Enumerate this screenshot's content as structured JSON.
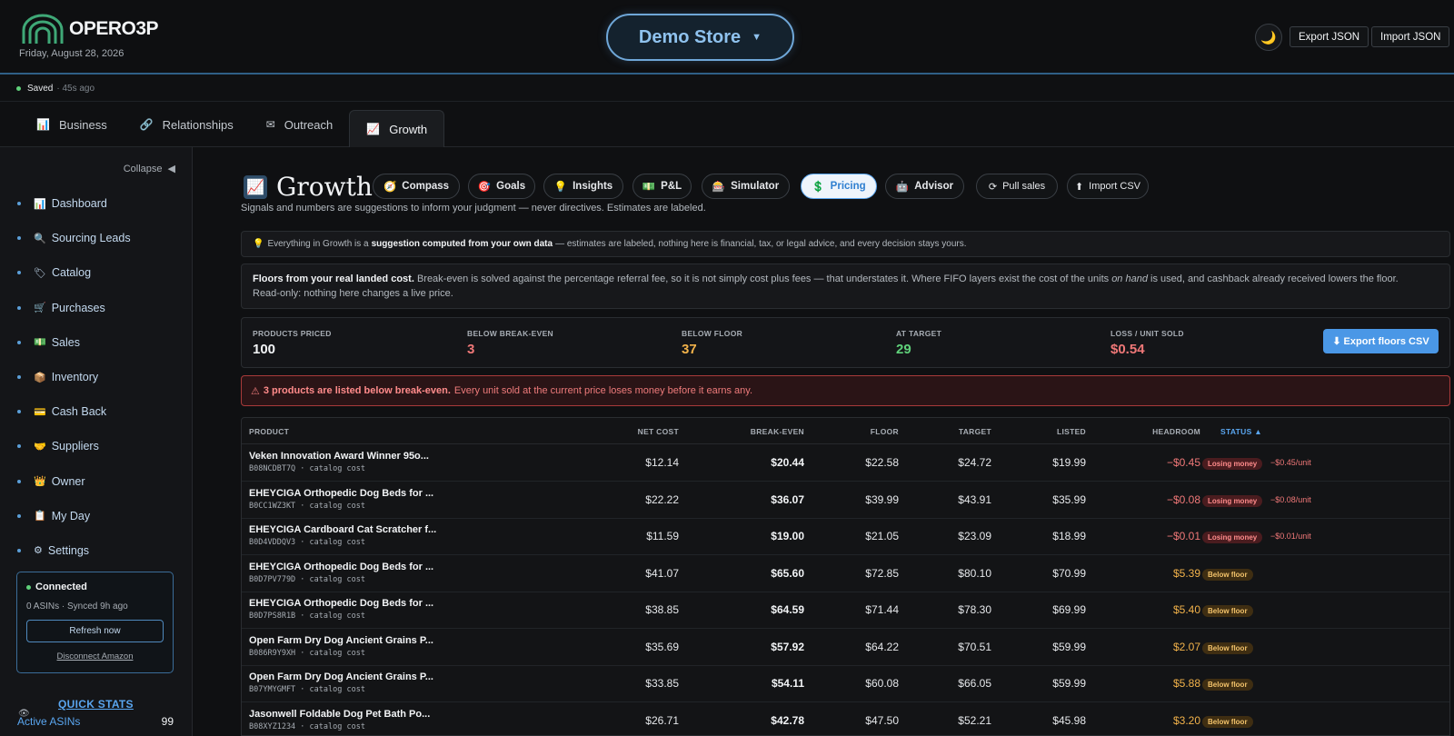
{
  "header": {
    "brand": "OPERO3P",
    "date": "Friday, August 28, 2026",
    "store": "Demo Store",
    "export_json": "Export JSON",
    "import_json": "Import JSON"
  },
  "status": {
    "saved": "Saved",
    "ago": "· 45s ago"
  },
  "tabs": [
    {
      "icon": "📊",
      "label": "Business"
    },
    {
      "icon": "🔗",
      "label": "Relationships"
    },
    {
      "icon": "✉",
      "label": "Outreach"
    },
    {
      "icon": "📈",
      "label": "Growth"
    }
  ],
  "sidebar": {
    "collapse": "Collapse",
    "items": [
      {
        "icon": "📊",
        "label": "Dashboard"
      },
      {
        "icon": "🔍",
        "label": "Sourcing Leads"
      },
      {
        "icon": "🏷",
        "label": "Catalog"
      },
      {
        "icon": "🛒",
        "label": "Purchases"
      },
      {
        "icon": "💵",
        "label": "Sales"
      },
      {
        "icon": "📦",
        "label": "Inventory"
      },
      {
        "icon": "💳",
        "label": "Cash Back"
      },
      {
        "icon": "🤝",
        "label": "Suppliers"
      },
      {
        "icon": "👑",
        "label": "Owner"
      },
      {
        "icon": "📋",
        "label": "My Day"
      },
      {
        "icon": "⚙",
        "label": "Settings"
      }
    ],
    "connection": {
      "title": "Connected",
      "sub": "0 ASINs · Synced 9h ago",
      "refresh": "Refresh now",
      "disconnect": "Disconnect Amazon"
    },
    "quick_stats": {
      "title": "QUICK STATS",
      "label": "Active ASINs",
      "value": "99"
    }
  },
  "main": {
    "title": "Growth",
    "pills": {
      "compass": "Compass",
      "goals": "Goals",
      "insights": "Insights",
      "pl": "P&L",
      "simulator": "Simulator",
      "pricing": "Pricing",
      "advisor": "Advisor",
      "pull_sales": "Pull sales",
      "import_csv": "Import CSV"
    },
    "subtitle": "Signals and numbers are suggestions to inform your judgment — never directives. Estimates are labeled.",
    "note": {
      "pre": "Everything in Growth is a",
      "bold": "suggestion computed from your own data",
      "post": "— estimates are labeled, nothing here is financial, tax, or legal advice, and every decision stays yours."
    },
    "floors": {
      "bold": "Floors from your real landed cost.",
      "text1": "Break-even is solved against the percentage referral fee, so it is not simply cost plus fees — that understates it. Where FIFO layers exist the cost of the units",
      "italic": "on hand",
      "text2": "is used, and cashback already received lowers the floor.",
      "line2": "Read-only: nothing here changes a live price."
    },
    "stats": {
      "products_priced_label": "PRODUCTS PRICED",
      "products_priced": "100",
      "below_be_label": "BELOW BREAK-EVEN",
      "below_be": "3",
      "below_floor_label": "BELOW FLOOR",
      "below_floor": "37",
      "at_target_label": "AT TARGET",
      "at_target": "29",
      "loss_label": "LOSS / UNIT SOLD",
      "loss": "$0.54",
      "export": "Export floors CSV"
    },
    "alert": {
      "bold": "3 products are listed below break-even.",
      "text": "Every unit sold at the current price loses money before it earns any."
    },
    "table": {
      "headers": {
        "product": "PRODUCT",
        "net_cost": "NET COST",
        "break_even": "BREAK-EVEN",
        "floor": "FLOOR",
        "target": "TARGET",
        "listed": "LISTED",
        "headroom": "HEADROOM",
        "status": "STATUS ▲"
      },
      "rows": [
        {
          "name": "Veken Innovation Award Winner 95o...",
          "sub": "B08NCDBT7Q · catalog cost",
          "net": "$12.14",
          "be": "$20.44",
          "floor": "$22.58",
          "target": "$24.72",
          "listed": "$19.99",
          "head": "−$0.45",
          "status": "Losing money",
          "perunit": "−$0.45/unit"
        },
        {
          "name": "EHEYCIGA Orthopedic Dog Beds for ...",
          "sub": "B0CC1WZ3KT · catalog cost",
          "net": "$22.22",
          "be": "$36.07",
          "floor": "$39.99",
          "target": "$43.91",
          "listed": "$35.99",
          "head": "−$0.08",
          "status": "Losing money",
          "perunit": "−$0.08/unit"
        },
        {
          "name": "EHEYCIGA Cardboard Cat Scratcher f...",
          "sub": "B0D4VDDQV3 · catalog cost",
          "net": "$11.59",
          "be": "$19.00",
          "floor": "$21.05",
          "target": "$23.09",
          "listed": "$18.99",
          "head": "−$0.01",
          "status": "Losing money",
          "perunit": "−$0.01/unit"
        },
        {
          "name": "EHEYCIGA Orthopedic Dog Beds for ...",
          "sub": "B0D7PV779D · catalog cost",
          "net": "$41.07",
          "be": "$65.60",
          "floor": "$72.85",
          "target": "$80.10",
          "listed": "$70.99",
          "head": "$5.39",
          "status": "Below floor",
          "perunit": ""
        },
        {
          "name": "EHEYCIGA Orthopedic Dog Beds for ...",
          "sub": "B0D7PS8R1B · catalog cost",
          "net": "$38.85",
          "be": "$64.59",
          "floor": "$71.44",
          "target": "$78.30",
          "listed": "$69.99",
          "head": "$5.40",
          "status": "Below floor",
          "perunit": ""
        },
        {
          "name": "Open Farm Dry Dog Ancient Grains P...",
          "sub": "B086R9Y9XH · catalog cost",
          "net": "$35.69",
          "be": "$57.92",
          "floor": "$64.22",
          "target": "$70.51",
          "listed": "$59.99",
          "head": "$2.07",
          "status": "Below floor",
          "perunit": ""
        },
        {
          "name": "Open Farm Dry Dog Ancient Grains P...",
          "sub": "B07YMYGMFT · catalog cost",
          "net": "$33.85",
          "be": "$54.11",
          "floor": "$60.08",
          "target": "$66.05",
          "listed": "$59.99",
          "head": "$5.88",
          "status": "Below floor",
          "perunit": ""
        },
        {
          "name": "Jasonwell Foldable Dog Pet Bath Po...",
          "sub": "B08XYZ1234 · catalog cost",
          "net": "$26.71",
          "be": "$42.78",
          "floor": "$47.50",
          "target": "$52.21",
          "listed": "$45.98",
          "head": "$3.20",
          "status": "Below floor",
          "perunit": ""
        }
      ]
    }
  },
  "colors": {
    "accent": "#5aa6f0",
    "loss": "#f07878",
    "warn": "#f2b24a",
    "good": "#5fd17a"
  }
}
